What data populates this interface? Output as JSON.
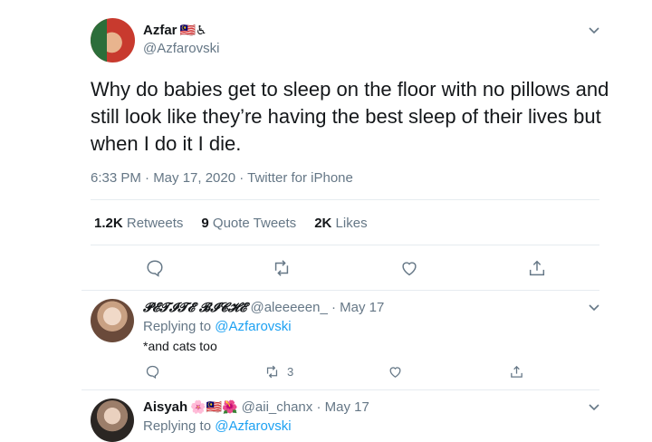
{
  "tweet": {
    "author_name": "Azfar",
    "author_emoji": "🇲🇾♿",
    "author_handle": "@Azfarovski",
    "text": "Why do babies get to sleep on the floor with no pillows and still look like they’re having the best sleep of their lives but when I do it I die.",
    "timestamp": "6:33 PM · May 17, 2020 · Twitter for iPhone",
    "stats": {
      "retweets_count": "1.2K",
      "retweets_label": "Retweets",
      "quotes_count": "9",
      "quotes_label": "Quote Tweets",
      "likes_count": "2K",
      "likes_label": "Likes"
    }
  },
  "replies": [
    {
      "name": "𝓟𝓔𝓣𝓘𝓣𝓔 𝓑𝓘𝓒𝓗𝓔",
      "handle": "@aleeeeen_ · May 17",
      "replying_prefix": "Replying to",
      "replying_to": "@Azfarovski",
      "text": "*and cats too",
      "retweet_count": "3"
    },
    {
      "name": "Aisyah",
      "emoji": "🌸🇲🇾🌺",
      "handle": "@aii_chanx · May 17",
      "replying_prefix": "Replying to",
      "replying_to": "@Azfarovski"
    }
  ],
  "icons": [
    "chevron-down-icon",
    "reply-icon",
    "retweet-icon",
    "like-icon",
    "share-icon"
  ],
  "colors": {
    "link": "#1da1f2",
    "secondary_text": "#657786",
    "divider": "#e6ecf0"
  }
}
